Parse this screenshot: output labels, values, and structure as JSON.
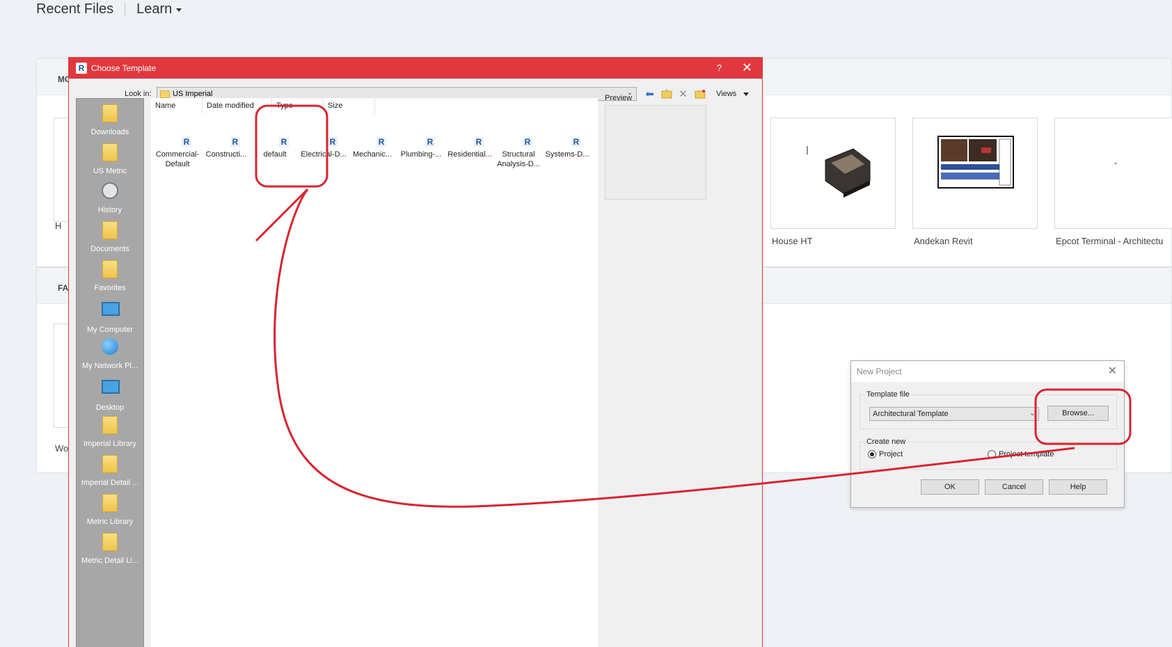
{
  "home": {
    "recent_files": "Recent Files",
    "learn": "Learn",
    "models_section_partial": "MO",
    "families_section_partial": "FA",
    "models": [
      {
        "label": "House HT"
      },
      {
        "label": "Andekan Revit"
      },
      {
        "label": "Epcot Terminal - Architectu"
      }
    ],
    "left_edge_model_label": "H",
    "left_edge_family_label": "Wo"
  },
  "choose_template": {
    "title": "Choose Template",
    "help": "?",
    "close": "✕",
    "look_in_label": "Look in:",
    "look_in_value": "US Imperial",
    "views_label": "Views",
    "preview_label": "Preview",
    "columns": [
      "Name",
      "Date modified",
      "Type",
      "Size"
    ],
    "places": [
      "Downloads",
      "US Metric",
      "History",
      "Documents",
      "Favorites",
      "My Computer",
      "My Network Pl...",
      "Desktop",
      "Imperial Library",
      "Imperial Detail ...",
      "Metric Library",
      "Metric Detail Li..."
    ],
    "files": [
      {
        "name": "Commercial-Default"
      },
      {
        "name": "Constructi..."
      },
      {
        "name": "default"
      },
      {
        "name": "Electrical-D..."
      },
      {
        "name": "Mechanic..."
      },
      {
        "name": "Plumbing-..."
      },
      {
        "name": "Residential..."
      },
      {
        "name": "Structural Analysis-D..."
      },
      {
        "name": "Systems-D..."
      }
    ]
  },
  "new_project": {
    "title": "New Project",
    "close": "✕",
    "template_file_label": "Template file",
    "template_value": "Architectural Template",
    "browse": "Browse...",
    "create_new_label": "Create new",
    "option_project": "Project",
    "option_template": "Project template",
    "selected": "Project",
    "ok": "OK",
    "cancel": "Cancel",
    "help": "Help"
  },
  "colors": {
    "title_bar": "#e0383e",
    "annotation": "#d8242e"
  },
  "icons": {
    "app": "revit-icon",
    "back": "back-arrow-icon",
    "up_folder": "up-folder-icon",
    "delete": "delete-icon",
    "new_folder": "new-folder-icon"
  }
}
